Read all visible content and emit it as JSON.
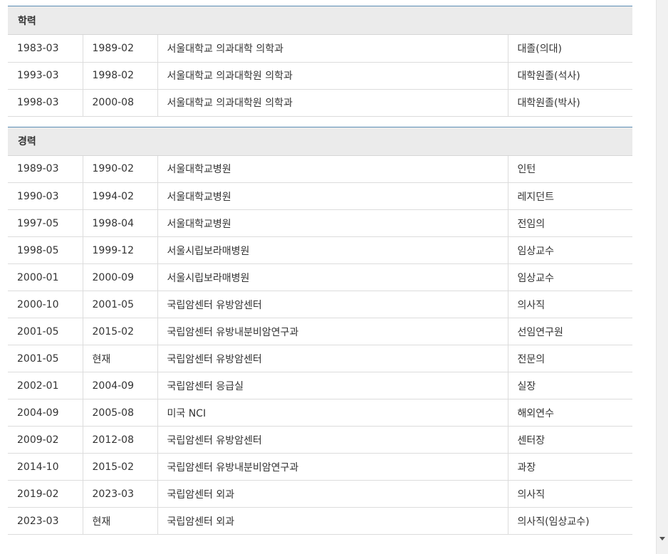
{
  "education": {
    "title": "학력",
    "rows": [
      {
        "start": "1983-03",
        "end": "1989-02",
        "institution": "서울대학교 의과대학 의학과",
        "position": "대졸(의대)"
      },
      {
        "start": "1993-03",
        "end": "1998-02",
        "institution": "서울대학교 의과대학원 의학과",
        "position": "대학원졸(석사)"
      },
      {
        "start": "1998-03",
        "end": "2000-08",
        "institution": "서울대학교 의과대학원 의학과",
        "position": "대학원졸(박사)"
      }
    ]
  },
  "career": {
    "title": "경력",
    "rows": [
      {
        "start": "1989-03",
        "end": "1990-02",
        "institution": "서울대학교병원",
        "position": "인턴"
      },
      {
        "start": "1990-03",
        "end": "1994-02",
        "institution": "서울대학교병원",
        "position": "레지던트"
      },
      {
        "start": "1997-05",
        "end": "1998-04",
        "institution": "서울대학교병원",
        "position": "전임의"
      },
      {
        "start": "1998-05",
        "end": "1999-12",
        "institution": "서울시립보라매병원",
        "position": "임상교수"
      },
      {
        "start": "2000-01",
        "end": "2000-09",
        "institution": "서울시립보라매병원",
        "position": "임상교수"
      },
      {
        "start": "2000-10",
        "end": "2001-05",
        "institution": "국립암센터 유방암센터",
        "position": "의사직"
      },
      {
        "start": "2001-05",
        "end": "2015-02",
        "institution": "국립암센터 유방내분비암연구과",
        "position": "선임연구원"
      },
      {
        "start": "2001-05",
        "end": "현재",
        "institution": "국립암센터 유방암센터",
        "position": "전문의"
      },
      {
        "start": "2002-01",
        "end": "2004-09",
        "institution": "국립암센터 응급실",
        "position": "실장"
      },
      {
        "start": "2004-09",
        "end": "2005-08",
        "institution": "미국 NCI",
        "position": "해외연수"
      },
      {
        "start": "2009-02",
        "end": "2012-08",
        "institution": "국립암센터 유방암센터",
        "position": "센터장"
      },
      {
        "start": "2014-10",
        "end": "2015-02",
        "institution": "국립암센터 유방내분비암연구과",
        "position": "과장"
      },
      {
        "start": "2019-02",
        "end": "2023-03",
        "institution": "국립암센터 외과",
        "position": "의사직"
      },
      {
        "start": "2023-03",
        "end": "현재",
        "institution": "국립암센터 외과",
        "position": "의사직(임상교수)"
      }
    ]
  },
  "icons": {
    "scroll_down": "chevron-down-icon"
  }
}
